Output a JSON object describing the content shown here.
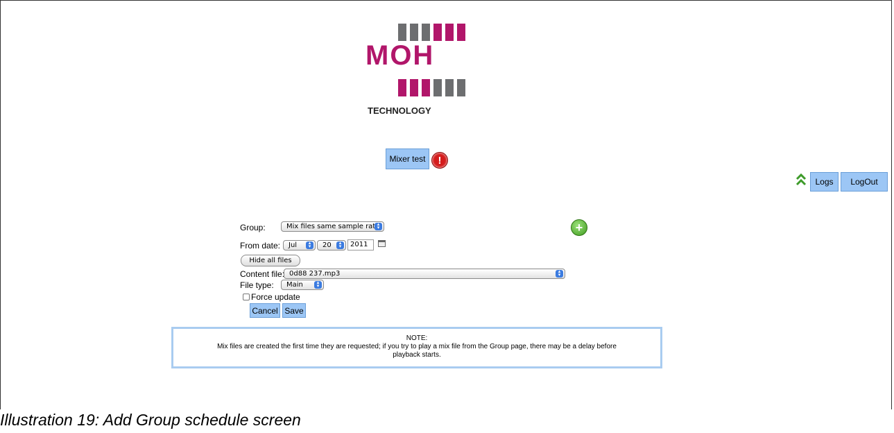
{
  "logo": {
    "text": "MOH",
    "subtitle": "TECHNOLOGY",
    "colors": {
      "magenta": "#b1166a",
      "gray": "#6d6e70"
    }
  },
  "header": {
    "mixer_test_label": "Mixer test",
    "alert_icon": "alert-icon",
    "collapse_icon": "chevron-up-double-icon",
    "logs_label": "Logs",
    "logout_label": "LogOut"
  },
  "form": {
    "group_label": "Group:",
    "group_value": "Mix files same sample rate",
    "add_icon": "plus-circle-icon",
    "from_date_label": "From date:",
    "month_value": "Jul",
    "day_value": "20",
    "year_value": "2011",
    "calendar_icon": "calendar-icon",
    "hide_files_label": "Hide all files",
    "content_file_label": "Content file:",
    "content_file_value": "0d88 237.mp3",
    "file_type_label": "File type:",
    "file_type_value": "Main",
    "force_update_label": "Force update",
    "cancel_label": "Cancel",
    "save_label": "Save"
  },
  "note": {
    "title": "NOTE:",
    "body": "Mix files are created the first time they are requested; if you try to play a mix file from the Group page, there may be a delay before playback starts."
  },
  "caption": "Illustration 19: Add Group schedule screen",
  "colors": {
    "button_blue": "#9cc6f5",
    "note_border": "#a9ccf0",
    "alert_red": "#d41c1c",
    "add_green": "#3f9a1f"
  }
}
